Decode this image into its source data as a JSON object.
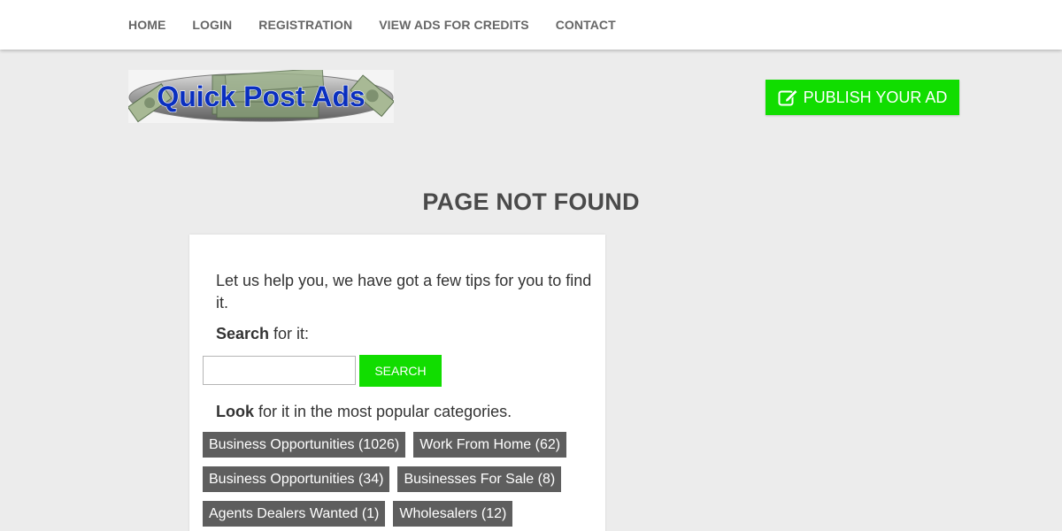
{
  "nav": {
    "items": [
      {
        "label": "Home"
      },
      {
        "label": "Login"
      },
      {
        "label": "Registration"
      },
      {
        "label": "View Ads For Credits"
      },
      {
        "label": "Contact"
      }
    ]
  },
  "header": {
    "logo_text": "Quick Post Ads",
    "publish_label": "Publish your ad",
    "publish_icon": "edit-icon"
  },
  "page_title": "Page not found",
  "content": {
    "tips_text": "Let us help you, we have got a few tips for you to find it.",
    "search_bold": "Search",
    "search_rest": " for it:",
    "search_input_value": "",
    "search_button": "Search",
    "look_bold": "Look",
    "look_rest": " for it in the most popular categories.",
    "categories": [
      {
        "label": "Business Opportunities (1026)"
      },
      {
        "label": "Work From Home (62)"
      },
      {
        "label": "Business Opportunities (34)"
      },
      {
        "label": "Businesses For Sale (8)"
      },
      {
        "label": "Agents Dealers Wanted (1)"
      },
      {
        "label": "Wholesalers (12)"
      }
    ]
  },
  "colors": {
    "accent_green": "#11dd00",
    "page_bg": "#ececec",
    "tag_bg": "#5e5e5e"
  }
}
